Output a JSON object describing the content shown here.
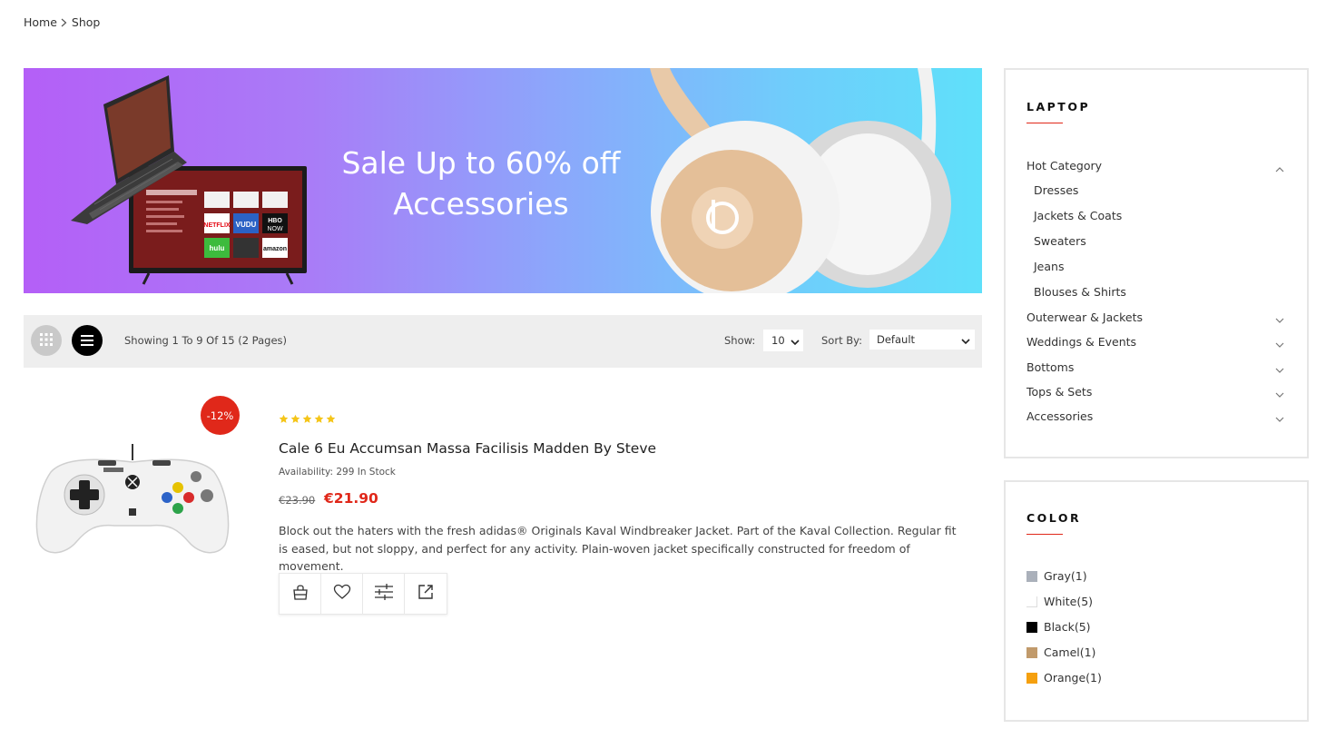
{
  "breadcrumb": {
    "home": "Home",
    "current": "Shop"
  },
  "banner": {
    "line1": "Sale Up to 60% off",
    "line2": "Accessories"
  },
  "toolbar": {
    "showing": "Showing 1 To 9 Of 15 (2 Pages)",
    "show_label": "Show:",
    "show_value": "10",
    "sort_label": "Sort By:",
    "sort_value": "Default"
  },
  "product": {
    "discount": "-12%",
    "rating": 5,
    "title": "Cale 6 Eu Accumsan Massa Facilisis Madden By Steve",
    "availability": "Availability: 299 In Stock",
    "old_price": "€23.90",
    "new_price": "€21.90",
    "description": "Block out the haters with the fresh adidas® Originals Kaval Windbreaker Jacket. Part of the Kaval Collection. Regular fit is eased, but not sloppy, and perfect for any activity. Plain-woven jacket specifically constructed for freedom of movement.",
    "actions": [
      "bag-icon",
      "heart-icon",
      "compare-icon",
      "external-link-icon"
    ]
  },
  "sidebar": {
    "laptop": {
      "title": "LAPTOP",
      "hot_category": "Hot Category",
      "sub_items": [
        "Dresses",
        "Jackets & Coats",
        "Sweaters",
        "Jeans",
        "Blouses & Shirts"
      ],
      "categories": [
        "Outerwear & Jackets",
        "Weddings & Events",
        "Bottoms",
        "Tops & Sets",
        "Accessories"
      ]
    },
    "color": {
      "title": "COLOR",
      "items": [
        {
          "label": "Gray(1)",
          "color": "#aab0ba"
        },
        {
          "label": "White(5)",
          "color": "#ffffff"
        },
        {
          "label": "Black(5)",
          "color": "#000000"
        },
        {
          "label": "Camel(1)",
          "color": "#c19a6b"
        },
        {
          "label": "Orange(1)",
          "color": "#f5a00f"
        }
      ]
    }
  },
  "colors": {
    "accent": "#e0281a",
    "star": "#f5c518"
  }
}
